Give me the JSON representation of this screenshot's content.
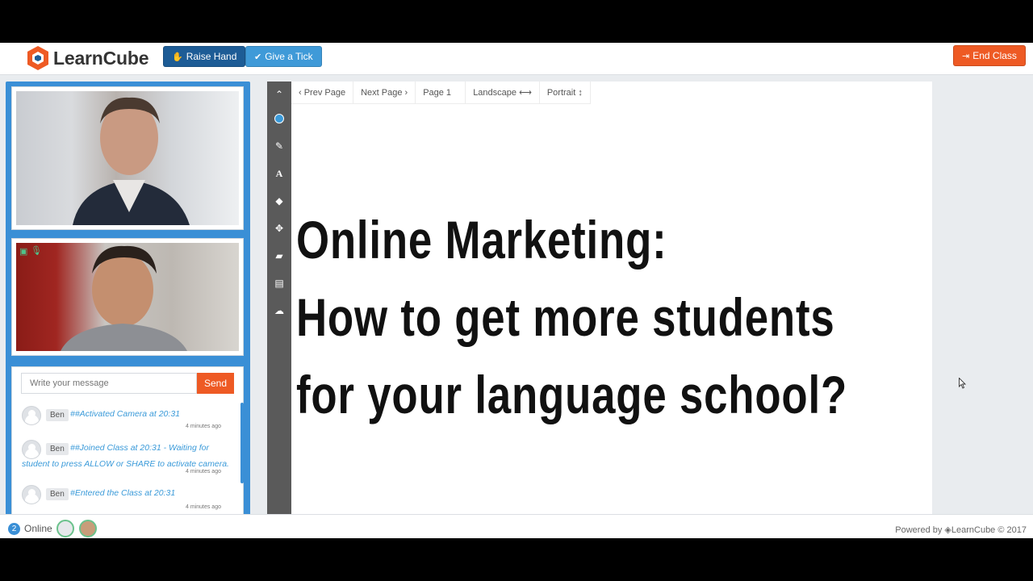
{
  "header": {
    "logo_text": "LearnCube",
    "raise_hand_label": "Raise Hand",
    "give_tick_label": "Give a Tick",
    "end_class_label": "End Class"
  },
  "colors": {
    "primary": "#3a8fd6",
    "dark_blue": "#1d5c96",
    "orange": "#ee5a24",
    "toolbar": "#5a5a5a"
  },
  "chat": {
    "placeholder": "Write your message",
    "send_label": "Send",
    "messages": [
      {
        "author": "Ben",
        "text": "##Activated Camera at 20:31",
        "time": "4 minutes ago"
      },
      {
        "author": "Ben",
        "text_line1": "##Joined Class at 20:31 - Waiting for",
        "text_line2": "student to press ALLOW or SHARE to activate camera.",
        "time": "4 minutes ago"
      },
      {
        "author": "Ben",
        "text": "#Entered the Class at 20:31",
        "time": "4 minutes ago"
      }
    ]
  },
  "tools": [
    "chevron-up-icon",
    "color-circle-icon",
    "pencil-icon",
    "text-icon",
    "shape-cube-icon",
    "move-icon",
    "eraser-icon",
    "save-icon",
    "cloud-upload-icon"
  ],
  "pagebar": {
    "prev": "‹ Prev Page",
    "next": "Next Page ›",
    "page": "Page 1",
    "landscape": "Landscape ⟷",
    "portrait": "Portrait ↕"
  },
  "board": {
    "line1": "Online Marketing:",
    "line2": "How to get more students",
    "line3": "for your language school?"
  },
  "footer": {
    "online_count": "2",
    "online_label": "Online",
    "powered": "Powered by ◈LearnCube © 2017"
  }
}
